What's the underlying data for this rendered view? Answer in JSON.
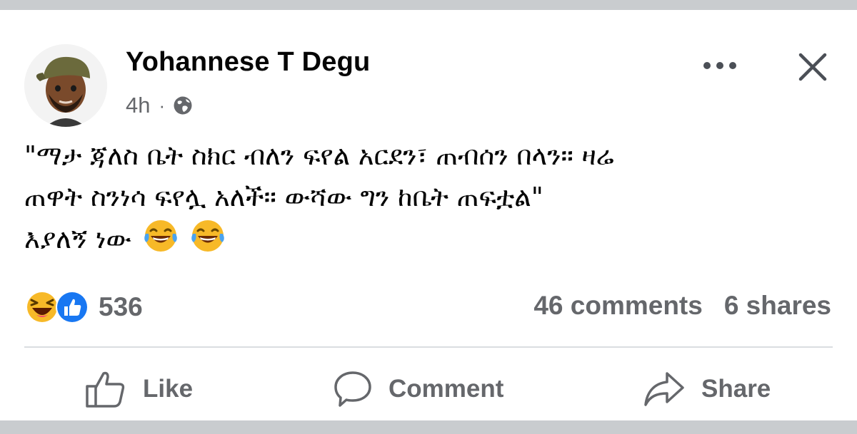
{
  "post": {
    "author": "Yohannese T Degu",
    "time": "4h",
    "separator": "·",
    "privacy_icon": "globe-icon",
    "text_lines": [
      "\"ማታ ጃለስ ቤት ስክር ብለን ፍየል አርደን፣ ጠብሰን በላን። ዛሬ",
      "ጠዋት ስንነሳ ፍየሏ አለች። ውሻው ግን ከቤት ጠፍቷል\"",
      "እያለኝ ነው"
    ],
    "emojis": [
      "laughing-crying-emoji",
      "laughing-crying-emoji"
    ]
  },
  "stats": {
    "reaction_icons": [
      "haha-reaction-icon",
      "like-reaction-icon"
    ],
    "reaction_count": "536",
    "comments": "46 comments",
    "shares": "6 shares"
  },
  "actions": {
    "like": "Like",
    "comment": "Comment",
    "share": "Share"
  },
  "colors": {
    "text_primary": "#050505",
    "text_secondary": "#65676b",
    "like_blue": "#1877f2",
    "emoji_yellow": "#f7b928"
  }
}
